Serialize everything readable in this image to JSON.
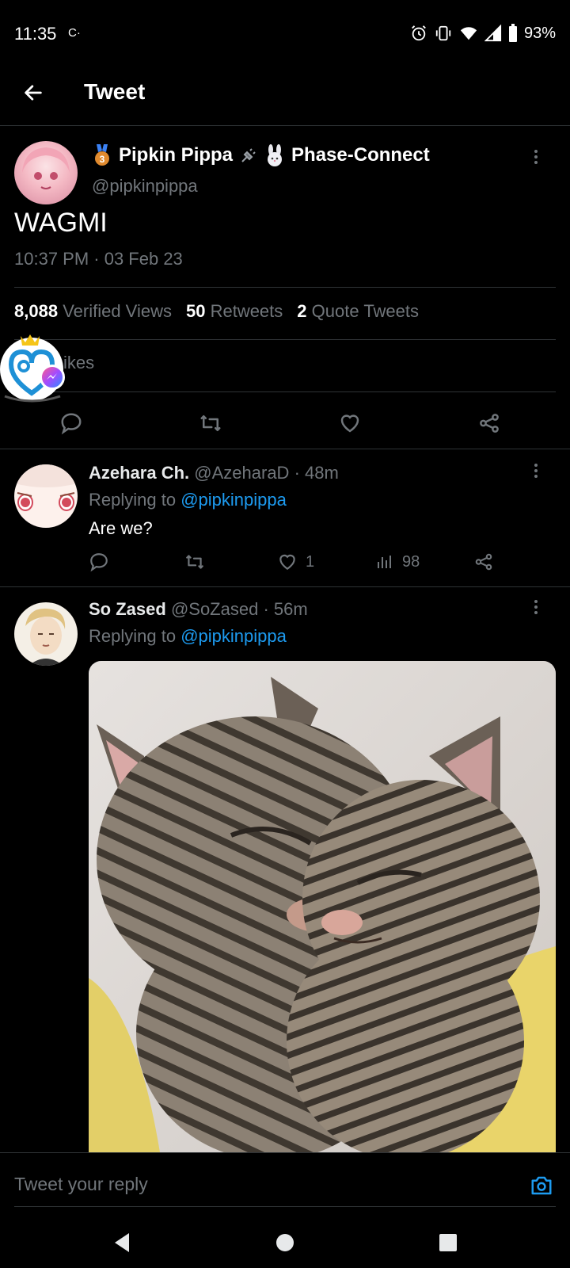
{
  "status_bar": {
    "time": "11:35",
    "notif_icon": "C·",
    "battery": "93%",
    "icons": [
      "alarm-icon",
      "vibrate-icon",
      "wifi-icon",
      "signal-icon",
      "battery-icon"
    ]
  },
  "header": {
    "title": "Tweet"
  },
  "main_tweet": {
    "name": "Pipkin Pippa",
    "name_suffix": "Phase-Connect",
    "handle": "@pipkinpippa",
    "text": "WAGMI",
    "timestamp": "10:37 PM · 03 Feb 23",
    "views_count": "8,088",
    "views_label": "Verified Views",
    "retweets_count": "50",
    "retweets_label": "Retweets",
    "quotes_count": "2",
    "quotes_label": "Quote Tweets",
    "likes_label": "ikes"
  },
  "replies": [
    {
      "name": "Azehara Ch.",
      "handle": "@AzeharaD",
      "time": "· 48m",
      "replying_prefix": "Replying to",
      "replying_to": "@pipkinpippa",
      "text": "Are we?",
      "likes": "1",
      "views": "98"
    },
    {
      "name": "So Zased",
      "handle": "@SoZased",
      "time": "· 56m",
      "replying_prefix": "Replying to",
      "replying_to": "@pipkinpippa"
    }
  ],
  "compose": {
    "placeholder": "Tweet your reply"
  },
  "colors": {
    "background": "#000000",
    "accent": "#1d9bf0",
    "muted": "#71767b",
    "divider": "#2f3336"
  }
}
